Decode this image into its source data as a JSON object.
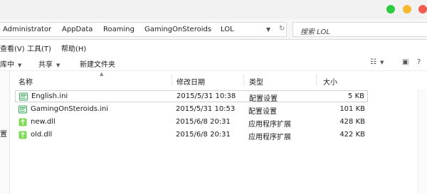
{
  "window": {
    "traffic_colors": [
      "#2ecc40",
      "#f5b82e",
      "#f25c4f"
    ]
  },
  "address": {
    "crumbs": [
      "Administrator",
      "AppData",
      "Roaming",
      "GamingOnSteroids",
      "LOL"
    ],
    "search_placeholder": "搜索 LOL"
  },
  "menu": {
    "items": [
      "查看(V)",
      "工具(T)",
      "帮助(H)"
    ]
  },
  "toolbar": {
    "partial_item": "库中",
    "share_label": "共享",
    "new_folder_label": "新建文件夹"
  },
  "sidebar": {
    "partial_label": "置"
  },
  "columns": {
    "name": "名称",
    "modified": "修改日期",
    "type": "类型",
    "size": "大小"
  },
  "files": [
    {
      "name": "English.ini",
      "modified": "2015/5/31 10:38",
      "type": "配置设置",
      "size": "5 KB",
      "icon": "ini-file-icon",
      "selected": true
    },
    {
      "name": "GamingOnSteroids.ini",
      "modified": "2015/5/31 10:53",
      "type": "配置设置",
      "size": "101 KB",
      "icon": "ini-file-icon",
      "selected": false
    },
    {
      "name": "new.dll",
      "modified": "2015/6/8 20:31",
      "type": "应用程序扩展",
      "size": "428 KB",
      "icon": "dll-file-icon",
      "selected": false
    },
    {
      "name": "old.dll",
      "modified": "2015/6/8 20:31",
      "type": "应用程序扩展",
      "size": "422 KB",
      "icon": "dll-file-icon",
      "selected": false
    }
  ]
}
